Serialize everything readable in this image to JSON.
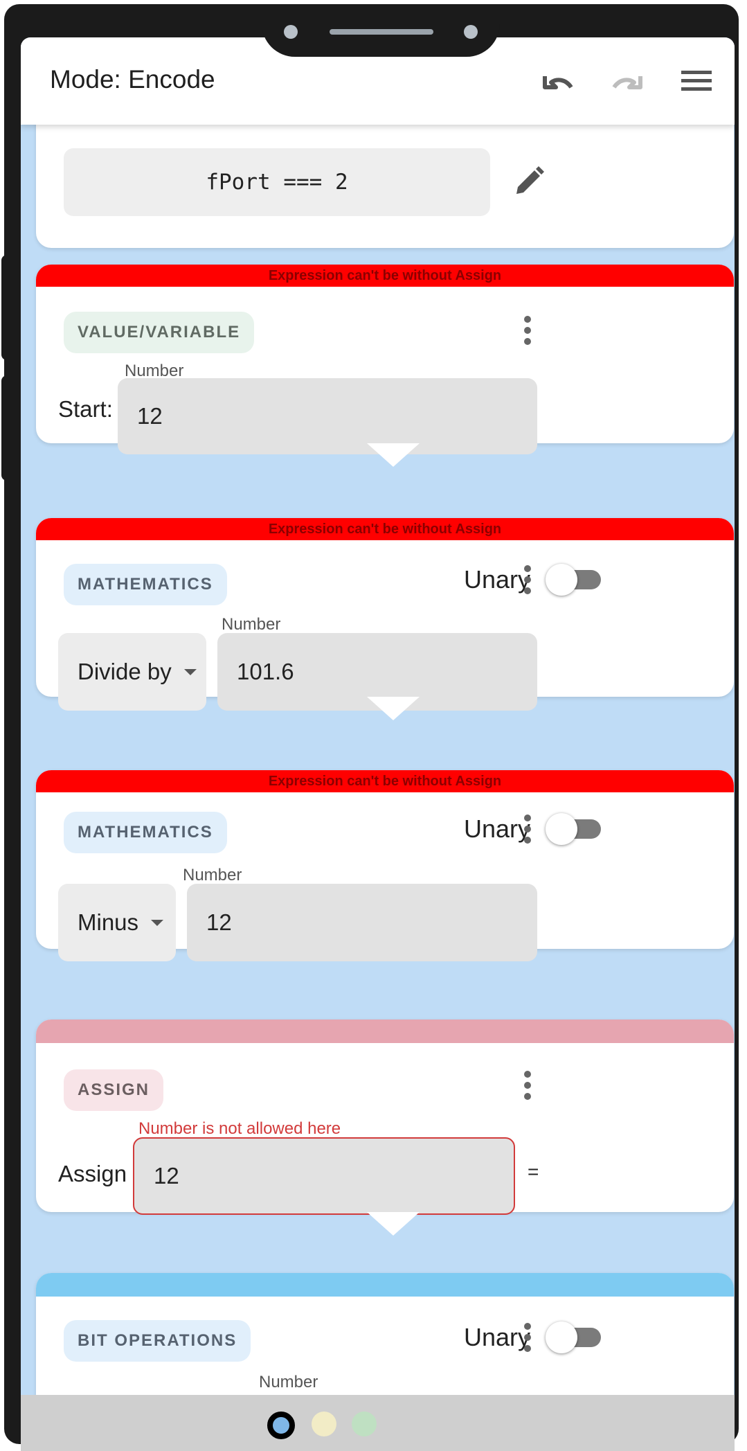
{
  "appbar": {
    "title": "Mode: Encode",
    "icons": [
      "undo-icon",
      "redo-icon",
      "menu-icon"
    ]
  },
  "condition_card": {
    "expression": "fPort === 2",
    "edit_icon": "pencil-icon"
  },
  "cards": {
    "value": {
      "error": "Expression can't be without Assign",
      "chip": "VALUE/VARIABLE",
      "field_label": "Number",
      "row_label": "Start:",
      "value": "12"
    },
    "math1": {
      "error": "Expression can't be without Assign",
      "chip": "MATHEMATICS",
      "toggle_label": "Unary",
      "operation": "Divide by",
      "field_label": "Number",
      "value": "101.6"
    },
    "math2": {
      "error": "Expression can't be without Assign",
      "chip": "MATHEMATICS",
      "toggle_label": "Unary",
      "operation": "Minus",
      "field_label": "Number",
      "value": "12"
    },
    "assign": {
      "chip": "ASSIGN",
      "row_label": "Assign",
      "error_label": "Number is not allowed here",
      "value": "12",
      "suffix": "="
    },
    "bitops": {
      "chip": "BIT OPERATIONS",
      "toggle_label": "Unary",
      "field_label": "Number"
    }
  },
  "colors": {
    "error_header": "#ff0000",
    "assign_header": "#e6a5b0",
    "bitops_header": "#7ecbf2",
    "screen_background": "#bfdcf6"
  },
  "pager": {
    "dots": [
      "#7fb7e8",
      "#f2ecc6",
      "#bfe0c2"
    ],
    "active_index": 0
  }
}
